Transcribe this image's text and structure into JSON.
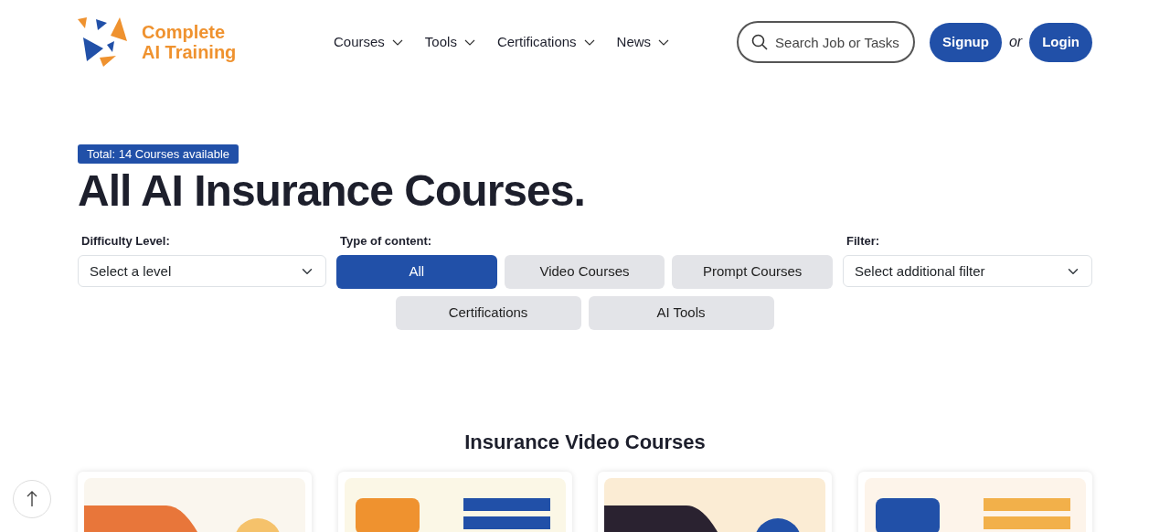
{
  "header": {
    "logo_text": "Complete AI Training",
    "nav": [
      {
        "label": "Courses"
      },
      {
        "label": "Tools"
      },
      {
        "label": "Certifications"
      },
      {
        "label": "News"
      }
    ],
    "search": {
      "placeholder": "Search Job or Tasks"
    },
    "signup": "Signup",
    "or": "or",
    "login": "Login"
  },
  "badge": "Total: 14 Courses available",
  "title": "All AI Insurance Courses.",
  "filters": {
    "difficulty": {
      "label": "Difficulty Level:",
      "value": "Select a level"
    },
    "content_type": {
      "label": "Type of content:",
      "options": [
        {
          "label": "All",
          "selected": true
        },
        {
          "label": "Video Courses",
          "selected": false
        },
        {
          "label": "Prompt Courses",
          "selected": false
        },
        {
          "label": "Certifications",
          "selected": false
        },
        {
          "label": "AI Tools",
          "selected": false
        }
      ]
    },
    "filter": {
      "label": "Filter:",
      "value": "Select additional filter"
    }
  },
  "section_title": "Insurance Video Courses"
}
